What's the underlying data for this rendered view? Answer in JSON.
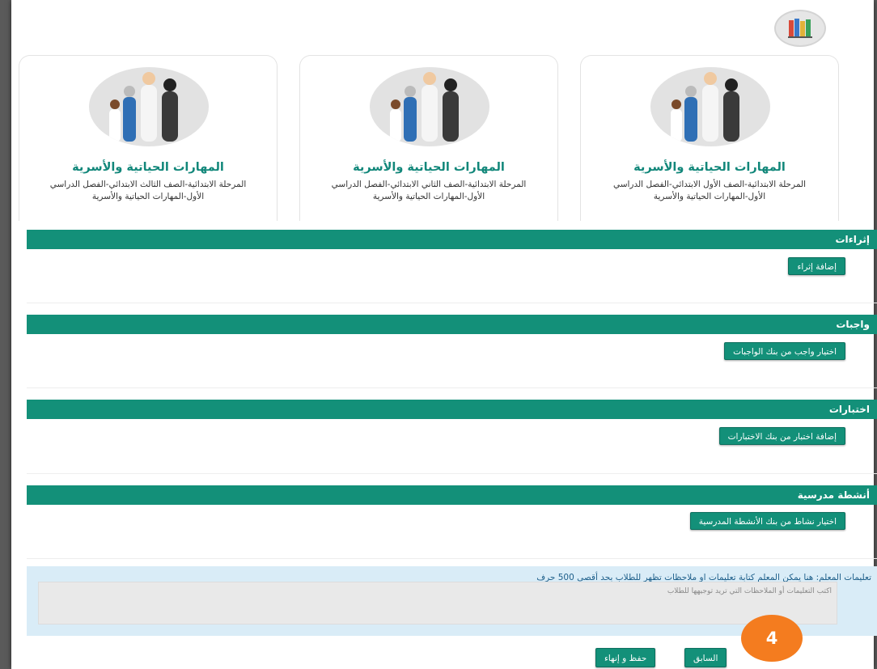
{
  "cards": [
    {
      "title": "المهارات الحياتية والأسرية",
      "subtitle_line1": "المرحلة الابتدائية-الصف الثالث الابتدائي-الفصل الدراسي",
      "subtitle_line2": "الأول-المهارات الحياتية والأسرية"
    },
    {
      "title": "المهارات الحياتية والأسرية",
      "subtitle_line1": "المرحلة الابتدائية-الصف الثاني الابتدائي-الفصل الدراسي",
      "subtitle_line2": "الأول-المهارات الحياتية والأسرية"
    },
    {
      "title": "المهارات الحياتية والأسرية",
      "subtitle_line1": "المرحلة الابتدائية-الصف الأول الابتدائي-الفصل الدراسي",
      "subtitle_line2": "الأول-المهارات الحياتية والأسرية"
    }
  ],
  "sections": {
    "enrichments": {
      "title": "إثراءات",
      "button": "إضافة إثراء"
    },
    "homework": {
      "title": "واجبات",
      "button": "اختيار واجب من بنك الواجبات"
    },
    "tests": {
      "title": "اختبارات",
      "button": "إضافة اختبار من بنك الاختبارات"
    },
    "activities": {
      "title": "أنشطة مدرسية",
      "button": "اختيار نشاط من بنك الأنشطة المدرسية"
    }
  },
  "notes": {
    "label": "تعليمات المعلم: هنا يمكن المعلم كتابة تعليمات او ملاحظات تظهر للطلاب بحد أقصى 500 حرف",
    "placeholder": "اكتب التعليمات أو الملاحظات التي تريد توجيهها للطلاب"
  },
  "footer": {
    "previous": "السابق",
    "save_finish": "حفظ و إنهاء"
  },
  "step_badge": "4",
  "colors": {
    "accent": "#139079",
    "title_text": "#12877a",
    "badge": "#f47c1f",
    "notes_bg": "#d9ecf7"
  },
  "icons": {
    "logo": "books-icon",
    "card_image": "family-illustration"
  }
}
